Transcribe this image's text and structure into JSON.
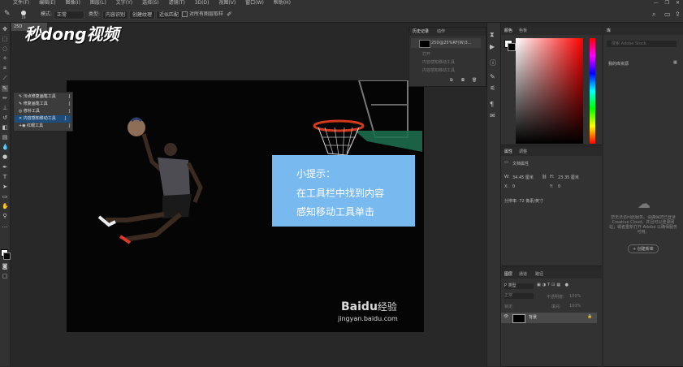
{
  "menubar": {
    "items": [
      "文件(F)",
      "编辑(E)",
      "图像(I)",
      "图层(L)",
      "文字(Y)",
      "选择(S)",
      "滤镜(T)",
      "3D(D)",
      "视图(V)",
      "窗口(W)",
      "帮助(H)"
    ]
  },
  "options": {
    "mode_label": "模式:",
    "mode_value": "正常",
    "type_label": "类型:",
    "btn_content": "内容识别",
    "btn_texture": "创建纹理",
    "btn_approx": "近似匹配",
    "sample_all": "对所有图层取样"
  },
  "doc_tab": "25D",
  "flyout": {
    "items": [
      {
        "label": "污点修复画笔工具",
        "key": "J"
      },
      {
        "label": "修复画笔工具",
        "key": "J"
      },
      {
        "label": "修补工具",
        "key": "J"
      },
      {
        "label": "内容感知移动工具",
        "key": "J"
      },
      {
        "label": "红眼工具",
        "key": "J"
      }
    ]
  },
  "logo": {
    "text": "秒dong视频"
  },
  "hint": {
    "title": "小提示：",
    "line1": "在工具栏中找到内容",
    "line2": "感知移动工具单击"
  },
  "watermark": {
    "brand": "Bai",
    "paw": "du",
    "suffix": "经验",
    "url": "jingyan.baidu.com"
  },
  "history_panel": {
    "tabs": [
      "历史记录",
      "动作"
    ],
    "snapshot": "25D@25%RF(W)3...",
    "steps": [
      "打开",
      "内容感知移动工具",
      "内容感知移动工具"
    ]
  },
  "color_panel": {
    "tabs": [
      "颜色",
      "色板"
    ]
  },
  "properties_panel": {
    "tabs": [
      "属性",
      "调整"
    ],
    "section": "文档属性",
    "w_label": "W:",
    "w_value": "34.45 厘米",
    "h_label": "H:",
    "h_value": "23.35 厘米",
    "x_label": "X:",
    "x_value": "0",
    "y_label": "Y:",
    "y_value": "0",
    "resolution": "分辨率: 72 像素/英寸"
  },
  "library_panel": {
    "tab": "库",
    "search_placeholder": "搜索 Adobe Stock",
    "dropdown": "我的库资源",
    "message": "您无法访问此服务。请确保您已登录 Creative Cloud，并且可以登录网站；或者重新打开 Adobe 以确保服务可用。",
    "create_button": "+ 创建新库"
  },
  "layers_panel": {
    "tabs": [
      "图层",
      "通道",
      "路径"
    ],
    "kind_filter": "P 类型",
    "blend": "正常",
    "opacity_label": "不透明度:",
    "opacity_value": "100%",
    "lock_label": "锁定:",
    "fill_label": "填充:",
    "fill_value": "100%",
    "layer_name": "背景"
  },
  "colors": {
    "accent_blue": "#78b9f0",
    "selection_blue": "#1e4d7b",
    "panel_bg": "#323232",
    "ui_bg": "#282828"
  }
}
